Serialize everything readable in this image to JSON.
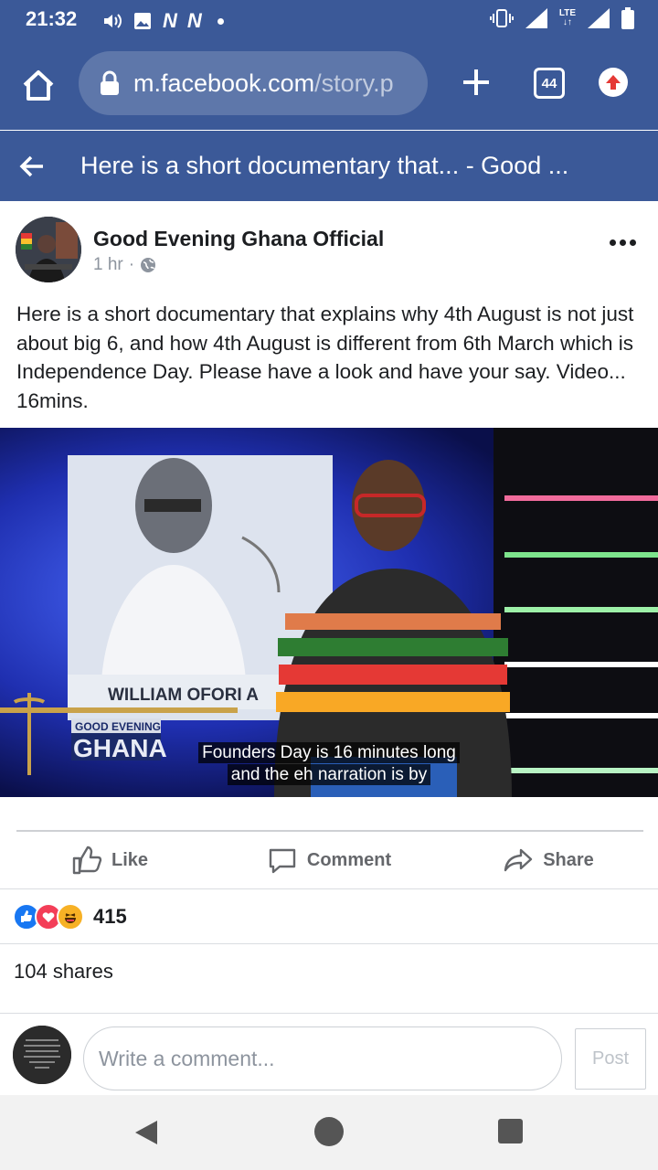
{
  "status_bar": {
    "time": "21:32",
    "network_left": "N",
    "lte_label": "LTE",
    "icons": [
      "volume-icon",
      "image-icon",
      "n-notification-icon",
      "dot-icon",
      "vibrate-icon",
      "signal-icon",
      "battery-icon"
    ]
  },
  "browser": {
    "url_domain": "m.facebook.com",
    "url_path": "/story.p",
    "tab_count": "44"
  },
  "header": {
    "title": "Here is a short documentary that... - Good ..."
  },
  "post": {
    "author": "Good Evening Ghana Official",
    "time": "1 hr",
    "separator": "·",
    "text": "Here is a short documentary that explains why 4th August is not just about big 6, and how 4th August is different from 6th March which is Independence Day. Please have a look and have your say. Video... 16mins.",
    "video": {
      "caption_name": "WILLIAM OFORI A",
      "logo_top": "GOOD EVENING",
      "logo_bottom": "GHANA",
      "subtitle_line1": "Founders Day is 16 minutes long",
      "subtitle_line2": "and the eh narration is by"
    }
  },
  "actions": {
    "like": "Like",
    "comment": "Comment",
    "share": "Share"
  },
  "stats": {
    "reaction_count": "415",
    "reactions": [
      "like-reaction-icon",
      "love-reaction-icon",
      "haha-reaction-icon"
    ],
    "shares": "104 shares"
  },
  "composer": {
    "placeholder": "Write a comment...",
    "post_label": "Post",
    "avatar_text": "If someone comes across your mind, check on them. God did that for a reason."
  },
  "colors": {
    "brand": "#3b5998",
    "text": "#1c1e21",
    "muted": "#65676b",
    "like_blue": "#1877f2",
    "love_red": "#f33e58",
    "haha_yellow": "#f7b125"
  }
}
